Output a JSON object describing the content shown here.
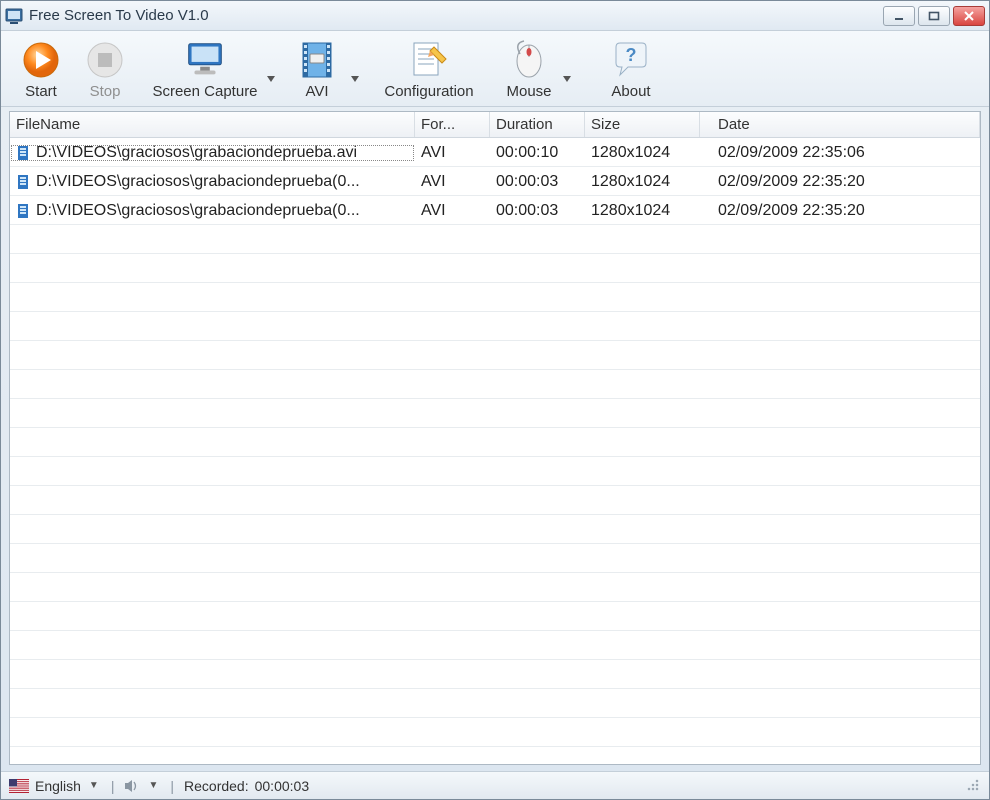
{
  "window": {
    "title": "Free Screen To Video V1.0"
  },
  "toolbar": {
    "start": "Start",
    "stop": "Stop",
    "screen_capture": "Screen Capture",
    "avi": "AVI",
    "configuration": "Configuration",
    "mouse": "Mouse",
    "about": "About"
  },
  "list": {
    "columns": {
      "filename": "FileName",
      "format": "For...",
      "duration": "Duration",
      "size": "Size",
      "date": "Date"
    },
    "rows": [
      {
        "filename": "D:\\VIDEOS\\graciosos\\grabaciondeprueba.avi",
        "format": "AVI",
        "duration": "00:00:10",
        "size": "1280x1024",
        "date": "02/09/2009 22:35:06"
      },
      {
        "filename": "D:\\VIDEOS\\graciosos\\grabaciondeprueba(0...",
        "format": "AVI",
        "duration": "00:00:03",
        "size": "1280x1024",
        "date": "02/09/2009 22:35:20"
      },
      {
        "filename": "D:\\VIDEOS\\graciosos\\grabaciondeprueba(0...",
        "format": "AVI",
        "duration": "00:00:03",
        "size": "1280x1024",
        "date": "02/09/2009 22:35:20"
      }
    ]
  },
  "status": {
    "language": "English",
    "recorded_label": "Recorded:",
    "recorded_time": "00:00:03"
  }
}
